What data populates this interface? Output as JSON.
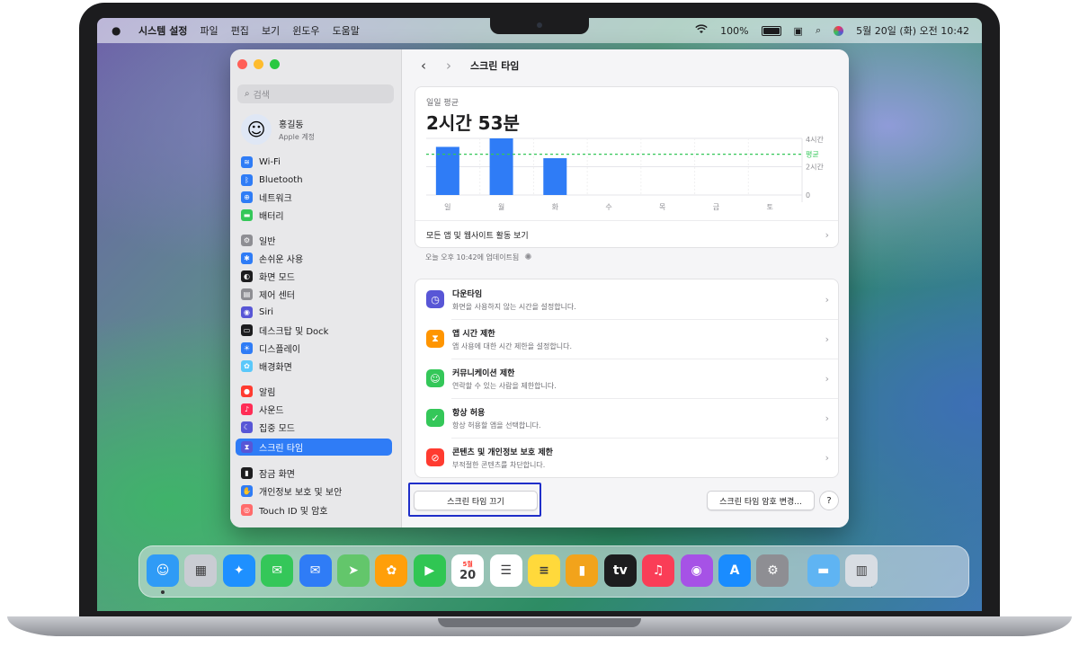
{
  "menubar": {
    "app_name": "시스템 설정",
    "menus": [
      "파일",
      "편집",
      "보기",
      "윈도우",
      "도움말"
    ],
    "battery": "100%",
    "datetime": "5월 20일 (화) 오전 10:42"
  },
  "sidebar": {
    "search_placeholder": "검색",
    "account": {
      "name": "홍길동",
      "subtitle": "Apple 계정"
    },
    "items": [
      {
        "label": "Wi-Fi",
        "icon": "wifi-icon",
        "color": "#2f7cf6"
      },
      {
        "label": "Bluetooth",
        "icon": "bluetooth-icon",
        "color": "#2f7cf6"
      },
      {
        "label": "네트워크",
        "icon": "globe-icon",
        "color": "#2f7cf6"
      },
      {
        "label": "배터리",
        "icon": "battery-icon",
        "color": "#34c759"
      },
      {
        "label": "일반",
        "icon": "gear-icon",
        "color": "#8e8e93"
      },
      {
        "label": "손쉬운 사용",
        "icon": "accessibility-icon",
        "color": "#2f7cf6"
      },
      {
        "label": "화면 모드",
        "icon": "appearance-icon",
        "color": "#1d1d1f"
      },
      {
        "label": "제어 센터",
        "icon": "control-center-icon",
        "color": "#8e8e93"
      },
      {
        "label": "Siri",
        "icon": "siri-icon",
        "color": "#5856d6"
      },
      {
        "label": "데스크탑 및 Dock",
        "icon": "desktop-dock-icon",
        "color": "#1d1d1f"
      },
      {
        "label": "디스플레이",
        "icon": "display-icon",
        "color": "#2f7cf6"
      },
      {
        "label": "배경화면",
        "icon": "wallpaper-icon",
        "color": "#5ac8fa"
      },
      {
        "label": "알림",
        "icon": "bell-icon",
        "color": "#ff3b30"
      },
      {
        "label": "사운드",
        "icon": "speaker-icon",
        "color": "#ff2d55"
      },
      {
        "label": "집중 모드",
        "icon": "moon-icon",
        "color": "#5856d6"
      },
      {
        "label": "스크린 타임",
        "icon": "hourglass-icon",
        "color": "#5856d6"
      },
      {
        "label": "잠금 화면",
        "icon": "lock-screen-icon",
        "color": "#1d1d1f"
      },
      {
        "label": "개인정보 보호 및 보안",
        "icon": "hand-icon",
        "color": "#2f7cf6"
      },
      {
        "label": "Touch ID 및 암호",
        "icon": "fingerprint-icon",
        "color": "#ff6b6b"
      }
    ],
    "selected": "스크린 타임"
  },
  "main": {
    "title": "스크린 타임",
    "summary": {
      "label": "일일 평균",
      "value": "2시간 53분",
      "link": "모든 앱 및 웹사이트 활동 보기"
    },
    "updated": "오늘 오후 10:42에 업데이트됨",
    "rows": [
      {
        "title": "다운타임",
        "subtitle": "화면을 사용하지 않는 시간을 설정합니다.",
        "icon": "downtime-icon",
        "color": "#5856d6"
      },
      {
        "title": "앱 시간 제한",
        "subtitle": "앱 사용에 대한 시간 제한을 설정합니다.",
        "icon": "hourglass-icon",
        "color": "#ff9500"
      },
      {
        "title": "커뮤니케이션 제한",
        "subtitle": "연락할 수 있는 사람을 제한합니다.",
        "icon": "contacts-icon",
        "color": "#34c759"
      },
      {
        "title": "항상 허용",
        "subtitle": "항상 허용할 앱을 선택합니다.",
        "icon": "checkmark-shield-icon",
        "color": "#34c759"
      },
      {
        "title": "콘텐츠 및 개인정보 보호 제한",
        "subtitle": "부적절한 콘텐츠를 차단합니다.",
        "icon": "no-entry-icon",
        "color": "#ff3b30"
      }
    ],
    "buttons": {
      "turn_off": "스크린 타임 끄기",
      "passcode": "스크린 타임 암호 변경...",
      "help": "?"
    }
  },
  "chart_data": {
    "type": "bar",
    "categories": [
      "일",
      "월",
      "화",
      "수",
      "목",
      "금",
      "토"
    ],
    "values": [
      3.4,
      4.0,
      2.6,
      0,
      0,
      0,
      0
    ],
    "average": 2.88,
    "average_label": "평균",
    "y_tick_labels": [
      "4시간",
      "2시간",
      "0"
    ],
    "y_ticks": [
      4,
      2,
      0
    ],
    "ylim": [
      0,
      4
    ],
    "bar_color": "#2f7cf6",
    "average_color": "#34c759"
  },
  "dock": {
    "apps": [
      {
        "name": "finder-icon",
        "color": "#2f9bf6",
        "glyph": "☺"
      },
      {
        "name": "launchpad-icon",
        "color": "#c9ccd3",
        "glyph": "▦"
      },
      {
        "name": "safari-icon",
        "color": "#1e90ff",
        "glyph": "✦"
      },
      {
        "name": "messages-icon",
        "color": "#34c759",
        "glyph": "✉"
      },
      {
        "name": "mail-icon",
        "color": "#2f7cf6",
        "glyph": "✉"
      },
      {
        "name": "maps-icon",
        "color": "#63c66b",
        "glyph": "➤"
      },
      {
        "name": "photos-icon",
        "color": "#ff9f0a",
        "glyph": "✿"
      },
      {
        "name": "facetime-icon",
        "color": "#30c653",
        "glyph": "▶"
      },
      {
        "name": "calendar-icon",
        "color": "#ffffff",
        "glyph": "20",
        "top_label": "5월"
      },
      {
        "name": "reminders-icon",
        "color": "#ffffff",
        "glyph": "☰"
      },
      {
        "name": "notes-icon",
        "color": "#ffd93b",
        "glyph": "≡"
      },
      {
        "name": "keynote-icon",
        "color": "#f2a31b",
        "glyph": "▮"
      },
      {
        "name": "tv-icon",
        "color": "#1c1c1e",
        "glyph": "tv"
      },
      {
        "name": "music-icon",
        "color": "#fa3d57",
        "glyph": "♫"
      },
      {
        "name": "podcasts-icon",
        "color": "#a652e6",
        "glyph": "◉"
      },
      {
        "name": "app-store-icon",
        "color": "#1a8cff",
        "glyph": "A"
      },
      {
        "name": "system-settings-icon",
        "color": "#8e8e93",
        "glyph": "⚙"
      },
      {
        "name": "downloads-folder-icon",
        "color": "#5fb4f3",
        "glyph": "▬"
      },
      {
        "name": "trash-icon",
        "color": "#d8dde3",
        "glyph": "▥"
      }
    ]
  }
}
